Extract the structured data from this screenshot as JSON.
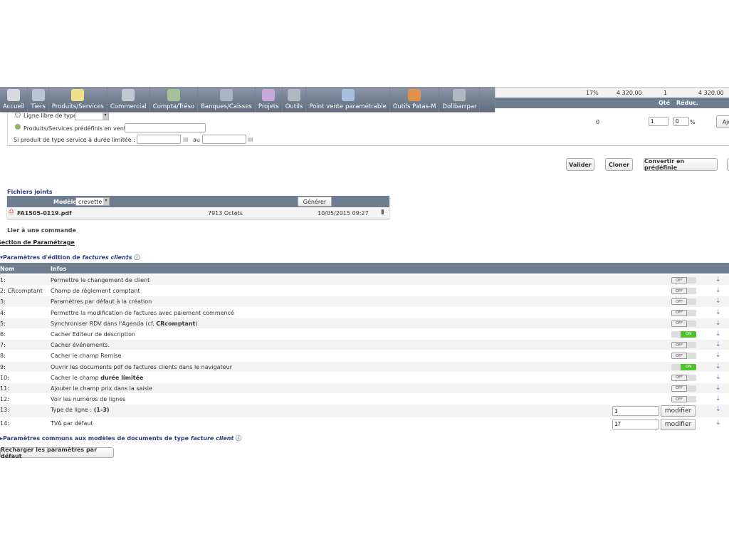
{
  "menu": [
    {
      "label": "Accueil",
      "icon": "home-icon",
      "color": "#d8d8e0"
    },
    {
      "label": "Tiers",
      "icon": "building-icon",
      "color": "#b8c4d4"
    },
    {
      "label": "Produits/Services",
      "icon": "product-icon",
      "color": "#f0e08a"
    },
    {
      "label": "Commercial",
      "icon": "commercial-icon",
      "color": "#c0c8d0"
    },
    {
      "label": "Compta/Tréso",
      "icon": "money-icon",
      "color": "#a8c098"
    },
    {
      "label": "Banques/Caisses",
      "icon": "bank-icon",
      "color": "#a8b4c4"
    },
    {
      "label": "Projets",
      "icon": "project-icon",
      "color": "#c8a8d8"
    },
    {
      "label": "Outils",
      "icon": "tools-icon",
      "color": "#b0b8c0"
    },
    {
      "label": "Point vente paramétrable",
      "icon": "pos-icon",
      "color": "#a8c0e0"
    },
    {
      "label": "Outils Patas-M",
      "icon": "patas-tools-icon",
      "color": "#e0904a"
    },
    {
      "label": "Dolibarrpar",
      "icon": "dolibarr-tools-icon",
      "color": "#b0b8c0"
    }
  ],
  "line": {
    "tva": "17%",
    "pu": "4 320,00",
    "qty": "1",
    "total": "4 320,00",
    "qty_header": "Qté",
    "reduc_header": "Réduc."
  },
  "form": {
    "free_line_label": "Ligne libre de type",
    "predef_label": "Produits/Services prédéfinis en vente",
    "service_label": "Si produit de type service à durée limitée : Du",
    "au_label": "au",
    "price_zero": "0",
    "qty_value": "1",
    "reduc_value": "0",
    "percent": "%",
    "add_button": "Ajo"
  },
  "actions": {
    "validate": "Valider",
    "clone": "Cloner",
    "convert": "Convertir en prédéfinie"
  },
  "files": {
    "title": "Fichiers joints",
    "model_label": "Modèle",
    "model_value": "crevette",
    "generate": "Générer",
    "file_name": "FA1505-0119.pdf",
    "file_size": "7913 Octets",
    "file_date": "10/05/2015 09:27"
  },
  "link_order": "Lier à une commande",
  "section_title": "Section de Paramétrage",
  "params_title_prefix": "Paramètres d'édition de ",
  "params_title_em": "factures clients",
  "table_headers": {
    "nom": "Nom",
    "infos": "Infos"
  },
  "params": [
    {
      "nom": "1:",
      "info": "Permettre le changement de client",
      "state": "OFF"
    },
    {
      "nom": "2: CRcomptant",
      "info": "Champ de règlement comptant",
      "state": "OFF"
    },
    {
      "nom": "3:",
      "info": "Paramètres par défaut à la création",
      "state": "OFF"
    },
    {
      "nom": "4:",
      "info": "Permettre la modification de factures avec paiement commencé",
      "state": "OFF"
    },
    {
      "nom": "5:",
      "info": "Synchroniser RDV dans l'Agenda (cf. ",
      "bold": "CRcomptant",
      "suffix": ")",
      "state": "OFF"
    },
    {
      "nom": "6:",
      "info": "Cacher Editeur de description",
      "state": "ON"
    },
    {
      "nom": "7:",
      "info": "Cacher événements.",
      "state": "OFF"
    },
    {
      "nom": "8:",
      "info": "Cacher le champ Remise",
      "state": "OFF"
    },
    {
      "nom": "9:",
      "info": "Ouvrir les documents pdf de factures clients dans le navigateur",
      "state": "ON"
    },
    {
      "nom": "10:",
      "info": "Cacher le champ ",
      "bold": "durée limitée",
      "state": "OFF"
    },
    {
      "nom": "11:",
      "info": "Ajouter le champ prix dans la saisie",
      "state": "OFF"
    },
    {
      "nom": "12:",
      "info": "Voir les numéros de lignes",
      "state": "OFF"
    },
    {
      "nom": "13:",
      "info": "Type de ligne : ",
      "bold": "(1-3)",
      "value": "1",
      "button": "modifier"
    },
    {
      "nom": "14:",
      "info": "TVA par défaut",
      "value": "17",
      "button": "modifier"
    }
  ],
  "common_prefix": "Paramètres communs aux modèles de documents de type ",
  "common_em": "facture client",
  "reload_button": "Recharger les paramètres par défaut"
}
